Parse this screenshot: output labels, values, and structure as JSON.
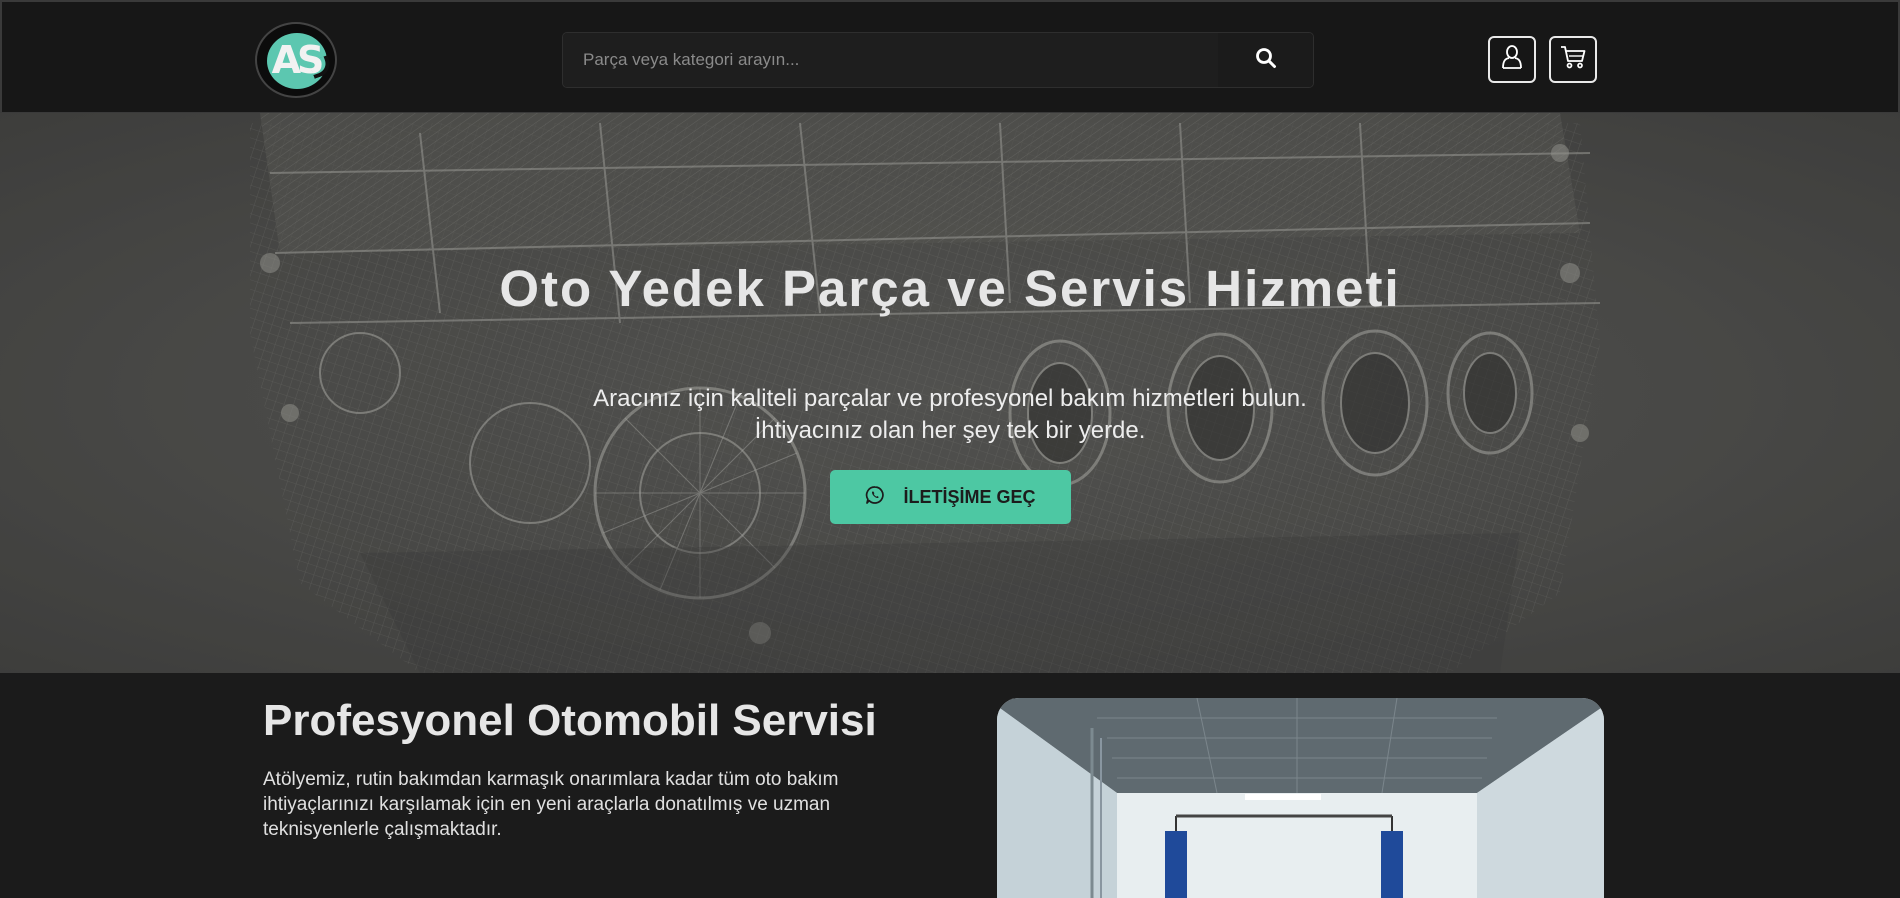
{
  "header": {
    "logo_text": "AS",
    "search": {
      "placeholder": "Parça veya kategori arayın..."
    },
    "icons": {
      "search": "search-icon",
      "user": "user-icon",
      "cart": "cart-icon"
    }
  },
  "hero": {
    "title": "Oto Yedek Parça ve Servis Hizmeti",
    "subtitle_line1": "Aracınız için kaliteli parçalar ve profesyonel bakım hizmetleri bulun.",
    "subtitle_line2": "İhtiyacınız olan her şey tek bir yerde.",
    "cta_label": "İLETİŞİME GEÇ",
    "cta_icon": "whatsapp-icon"
  },
  "service": {
    "title": "Profesyonel Otomobil Servisi",
    "text_line1": "Atölyemiz, rutin bakımdan karmaşık onarımlara kadar tüm oto bakım",
    "text_line2": "ihtiyaçlarınızı karşılamak için en yeni araçlarla donatılmış ve uzman",
    "text_line3": "teknisyenlerle çalışmaktadır."
  },
  "colors": {
    "accent": "#4dc8a3",
    "header_bg": "#171717",
    "page_bg": "#1b1b1b",
    "hero_overlay": "#4d4d4a"
  }
}
